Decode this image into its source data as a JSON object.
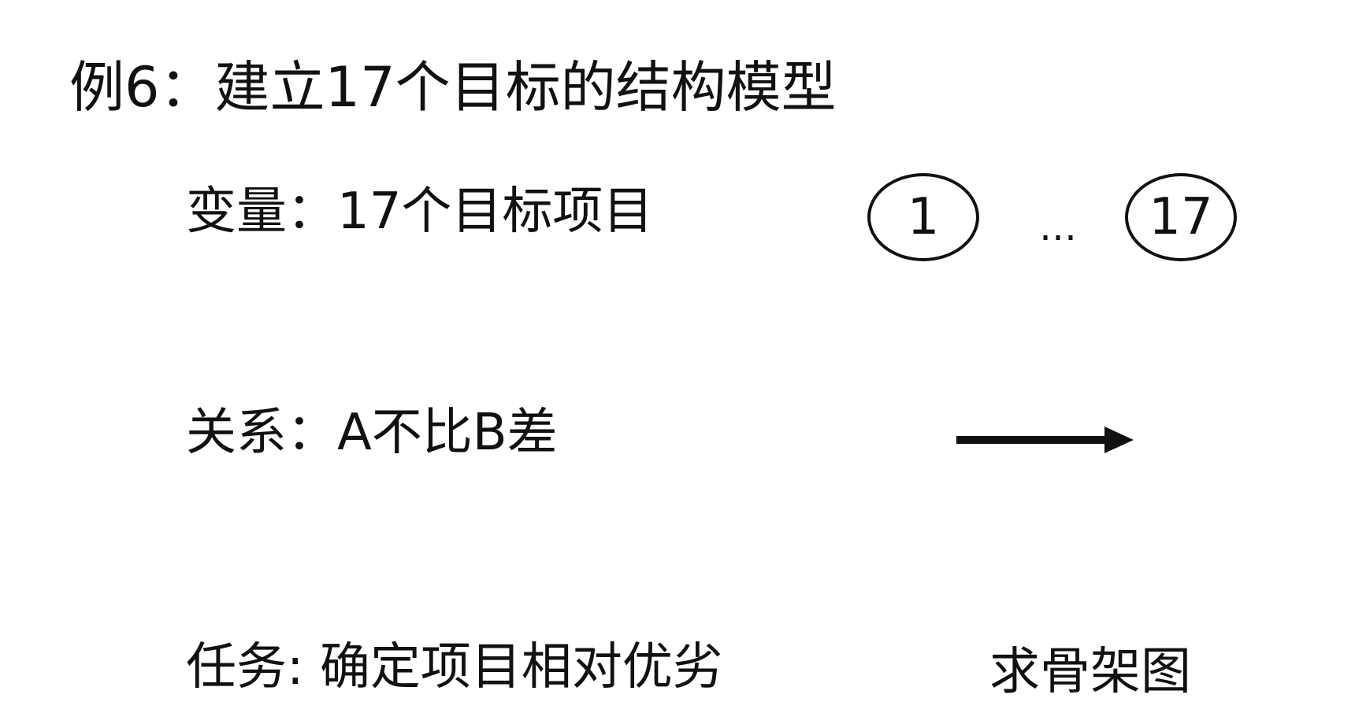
{
  "slide": {
    "title": "例6：建立17个目标的结构模型",
    "variables_text": "变量：17个目标项目",
    "relation_text": "关系：A不比B差",
    "task_text": "任务: 确定项目相对优劣",
    "skeleton_text": "求骨架图"
  },
  "diagram": {
    "node_first": "1",
    "ellipsis": "…",
    "node_last": "17",
    "arrow_icon": "right-arrow-icon"
  }
}
